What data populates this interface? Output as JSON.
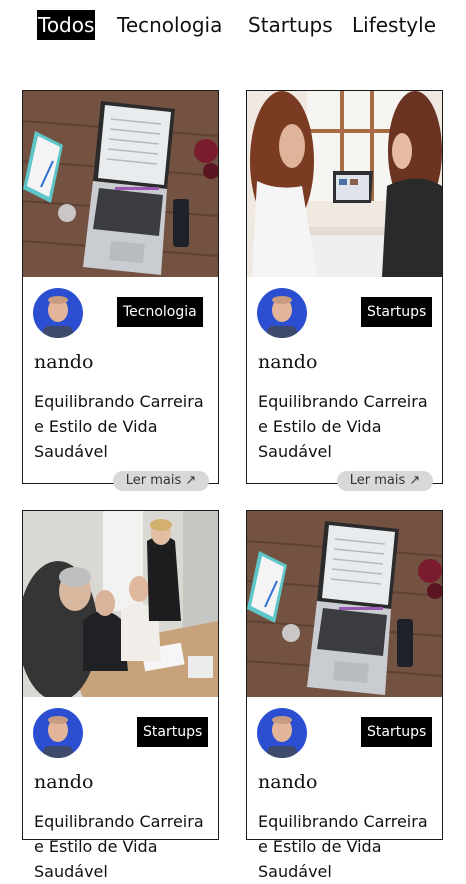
{
  "nav": {
    "tabs": [
      {
        "label": "Todos",
        "active": true
      },
      {
        "label": "Tecnologia"
      },
      {
        "label": "Startups"
      },
      {
        "label": "Lifestyle"
      }
    ]
  },
  "cards": [
    {
      "image": "laptop-desk-photo",
      "category": "Tecnologia",
      "author": "nando",
      "title": "Equilibrando Carreira e Estilo de Vida Saudável",
      "read_more": "Ler mais"
    },
    {
      "image": "office-meeting-photo",
      "category": "Startups",
      "author": "nando",
      "title": "Equilibrando Carreira e Estilo de Vida Saudável",
      "read_more": "Ler mais"
    },
    {
      "image": "team-meeting-photo",
      "category": "Startups",
      "author": "nando",
      "title": "Equilibrando Carreira e Estilo de Vida Saudável"
    },
    {
      "image": "laptop-desk-photo",
      "category": "Startups",
      "author": "nando",
      "title": "Equilibrando Carreira e Estilo de Vida Saudável"
    }
  ],
  "icons": {
    "read_more": "arrow-up-right-icon"
  },
  "colors": {
    "badge_bg": "#000000",
    "active_tab_bg": "#000000",
    "read_more_bg": "#d8d8d8"
  }
}
